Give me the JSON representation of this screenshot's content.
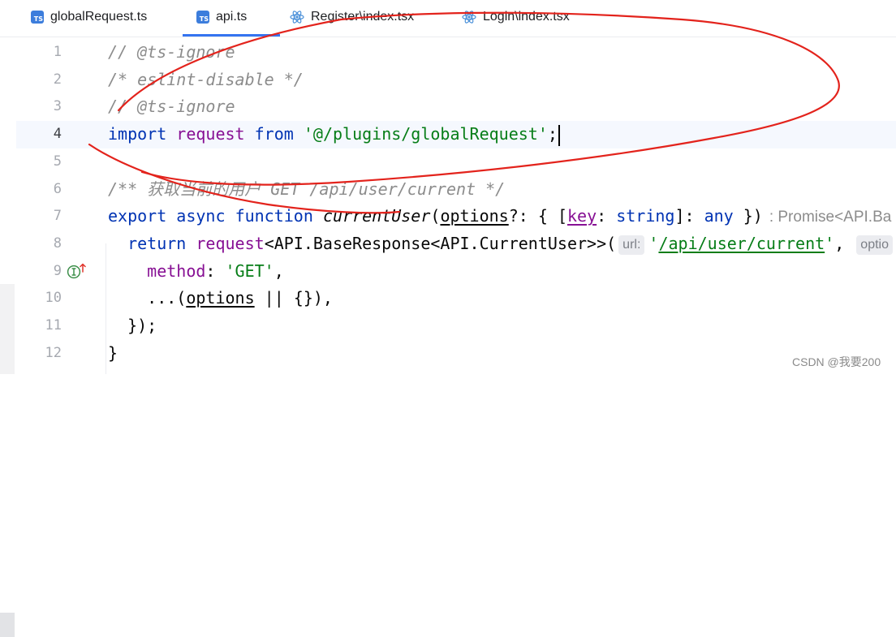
{
  "colors": {
    "accent": "#3574f0",
    "keyword": "#0033b3",
    "string": "#067d17",
    "comment": "#8c8c8c",
    "identifier": "#871094",
    "plain": "#080808",
    "current_line": "#f5f8fe",
    "annotation": "#e3231c",
    "ts_icon": "#3c7ddc",
    "react_icon": "#4a90d9",
    "gutter_number": "#a6a9b0",
    "hint_bg": "#ebecf0",
    "hint_text": "#7c7f86",
    "type_hint": "#8c8c8c"
  },
  "tabs": [
    {
      "label": "globalRequest.ts",
      "icon": "typescript-file-icon",
      "icon_text": "TS",
      "active": false
    },
    {
      "label": "api.ts",
      "icon": "typescript-file-icon",
      "icon_text": "TS",
      "active": true
    },
    {
      "label": "Register\\index.tsx",
      "icon": "react-file-icon",
      "active": false
    },
    {
      "label": "Login\\index.tsx",
      "icon": "react-file-icon",
      "active": false
    }
  ],
  "editor": {
    "current_line": 4,
    "gutter_marker": {
      "line": 9,
      "icon": "implements-marker-icon"
    },
    "line_numbers": [
      "1",
      "2",
      "3",
      "4",
      "5",
      "6",
      "7",
      "8",
      "9",
      "10",
      "11",
      "12"
    ],
    "lines": [
      {
        "tokens": [
          {
            "text": "// @ts-ignore",
            "kind": "comment"
          }
        ]
      },
      {
        "tokens": [
          {
            "text": "/* eslint-disable */",
            "kind": "comment"
          }
        ]
      },
      {
        "tokens": [
          {
            "text": "// @ts-ignore",
            "kind": "comment"
          }
        ]
      },
      {
        "tokens": [
          {
            "text": "import",
            "kind": "keyword"
          },
          {
            "text": " ",
            "kind": "plain"
          },
          {
            "text": "request",
            "kind": "ident"
          },
          {
            "text": " ",
            "kind": "plain"
          },
          {
            "text": "from",
            "kind": "keyword"
          },
          {
            "text": " ",
            "kind": "plain"
          },
          {
            "text": "'@/plugins/globalRequest'",
            "kind": "string"
          },
          {
            "text": ";",
            "kind": "plain"
          }
        ]
      },
      {
        "tokens": []
      },
      {
        "tokens": [
          {
            "text": "/** 获取当前的用户 GET /api/user/current */",
            "kind": "comment"
          }
        ]
      },
      {
        "tokens": [
          {
            "text": "export",
            "kind": "keyword"
          },
          {
            "text": " ",
            "kind": "plain"
          },
          {
            "text": "async",
            "kind": "keyword"
          },
          {
            "text": " ",
            "kind": "plain"
          },
          {
            "text": "function",
            "kind": "keyword"
          },
          {
            "text": " ",
            "kind": "plain"
          },
          {
            "text": "currentUser",
            "kind": "fn"
          },
          {
            "text": "(",
            "kind": "plain"
          },
          {
            "text": "options",
            "kind": "param"
          },
          {
            "text": "?: { [",
            "kind": "plain"
          },
          {
            "text": "key",
            "kind": "param-ident"
          },
          {
            "text": ": ",
            "kind": "plain"
          },
          {
            "text": "string",
            "kind": "keyword"
          },
          {
            "text": "]: ",
            "kind": "plain"
          },
          {
            "text": "any",
            "kind": "keyword"
          },
          {
            "text": " })",
            "kind": "plain"
          },
          {
            "text": ": Promise<API.Ba",
            "kind": "type-hint"
          }
        ]
      },
      {
        "tokens": [
          {
            "text": "  ",
            "kind": "plain"
          },
          {
            "text": "return",
            "kind": "keyword"
          },
          {
            "text": " ",
            "kind": "plain"
          },
          {
            "text": "request",
            "kind": "ident"
          },
          {
            "text": "<API.BaseResponse<API.CurrentUser>>(",
            "kind": "plain"
          },
          {
            "text": "url:",
            "kind": "hint"
          },
          {
            "text": "'",
            "kind": "string"
          },
          {
            "text": "/api/user/current",
            "kind": "link"
          },
          {
            "text": "'",
            "kind": "string"
          },
          {
            "text": ", ",
            "kind": "plain"
          },
          {
            "text": "optio",
            "kind": "hint"
          }
        ]
      },
      {
        "tokens": [
          {
            "text": "    ",
            "kind": "plain"
          },
          {
            "text": "method",
            "kind": "prop"
          },
          {
            "text": ": ",
            "kind": "plain"
          },
          {
            "text": "'GET'",
            "kind": "string"
          },
          {
            "text": ",",
            "kind": "plain"
          }
        ]
      },
      {
        "tokens": [
          {
            "text": "    ...(",
            "kind": "plain"
          },
          {
            "text": "options",
            "kind": "param"
          },
          {
            "text": " || {}),",
            "kind": "plain"
          }
        ]
      },
      {
        "tokens": [
          {
            "text": "  });",
            "kind": "plain"
          }
        ]
      },
      {
        "tokens": [
          {
            "text": "}",
            "kind": "plain"
          }
        ]
      }
    ]
  },
  "watermark": "CSDN @我要200"
}
